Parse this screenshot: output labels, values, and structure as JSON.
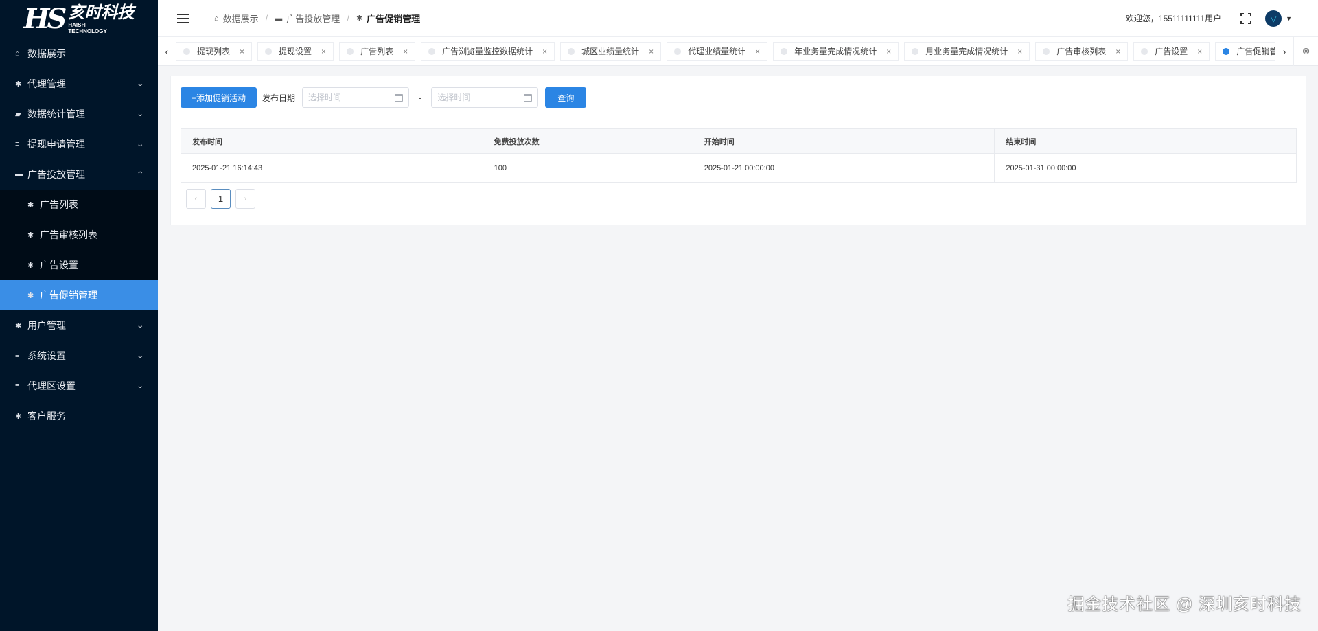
{
  "logo": {
    "mark": "HS",
    "cn": "亥时科技",
    "en1": "HAISHI",
    "en2": "TECHNOLOGY"
  },
  "sidebar": {
    "items": [
      {
        "label": "数据展示",
        "icon": "home-icon"
      },
      {
        "label": "代理管理",
        "icon": "asterisk-icon"
      },
      {
        "label": "数据统计管理",
        "icon": "chat-icon"
      },
      {
        "label": "提现申请管理",
        "icon": "list-icon"
      },
      {
        "label": "广告投放管理",
        "icon": "folder-icon"
      },
      {
        "label": "用户管理",
        "icon": "asterisk-icon"
      },
      {
        "label": "系统设置",
        "icon": "list-icon"
      },
      {
        "label": "代理区设置",
        "icon": "list-icon"
      },
      {
        "label": "客户服务",
        "icon": "asterisk-icon"
      }
    ],
    "sub_items": [
      {
        "label": "广告列表"
      },
      {
        "label": "广告审核列表"
      },
      {
        "label": "广告设置"
      },
      {
        "label": "广告促销管理"
      }
    ]
  },
  "header": {
    "breadcrumb": [
      "数据展示",
      "广告投放管理",
      "广告促销管理"
    ],
    "welcome": "欢迎您，15511111111用户"
  },
  "tabs": [
    {
      "label": "提现列表"
    },
    {
      "label": "提现设置"
    },
    {
      "label": "广告列表"
    },
    {
      "label": "广告浏览量监控数据统计"
    },
    {
      "label": "城区业绩量统计"
    },
    {
      "label": "代理业绩量统计"
    },
    {
      "label": "年业务量完成情况统计"
    },
    {
      "label": "月业务量完成情况统计"
    },
    {
      "label": "广告审核列表"
    },
    {
      "label": "广告设置"
    },
    {
      "label": "广告促销管理",
      "active": true
    }
  ],
  "toolbar": {
    "add_label": "+添加促销活动",
    "filter_label": "发布日期",
    "start_placeholder": "选择时间",
    "end_placeholder": "选择时间",
    "dash": "-",
    "query_label": "查询"
  },
  "table": {
    "columns": [
      "发布时间",
      "免费投放次数",
      "开始时间",
      "结束时间"
    ],
    "rows": [
      [
        "2025-01-21 16:14:43",
        "100",
        "2025-01-21 00:00:00",
        "2025-01-31 00:00:00"
      ]
    ]
  },
  "pager": {
    "prev": "‹",
    "current": "1",
    "next": "›"
  },
  "watermark": "掘金技术社区 @ 深圳亥时科技",
  "colors": {
    "sidebar_bg": "#001529",
    "accent": "#2b85e4",
    "active_item": "#3a8ee6"
  }
}
